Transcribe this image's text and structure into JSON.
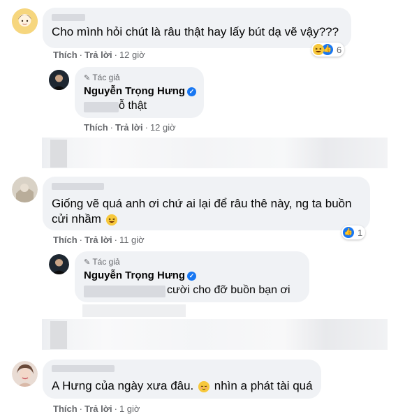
{
  "actions": {
    "like": "Thích",
    "reply": "Trả lời"
  },
  "comments": [
    {
      "text": "Cho mình hỏi chút là râu thật hay lấy bút dạ vẽ vậy???",
      "time": "12 giờ",
      "reaction_count": "6",
      "reaction_icons": [
        "laughing-emoji",
        "like-icon"
      ]
    },
    {
      "author_tag": "Tác giả",
      "author": "Nguyễn Trọng Hưng",
      "text": "ỗ thật",
      "time": "12 giờ"
    },
    {
      "text_line1": "Giống vẽ quá anh ơi chứ ai lại để râu thê này, ng ta buồn",
      "text_line2": "cửi nhầm",
      "time": "11 giờ",
      "reaction_count": "1",
      "reaction_icons": [
        "like-icon"
      ]
    },
    {
      "author_tag": "Tác giả",
      "author": "Nguyễn Trọng Hưng",
      "text": "cười cho đỡ buồn bạn ơi"
    },
    {
      "text": "A Hưng của ngày xưa đâu.",
      "text_tail": "nhìn a phát tài quá",
      "time": "1 giờ"
    }
  ],
  "colors": {
    "bubble": "#f0f2f5",
    "meta": "#65676b",
    "accent": "#1877f2"
  }
}
